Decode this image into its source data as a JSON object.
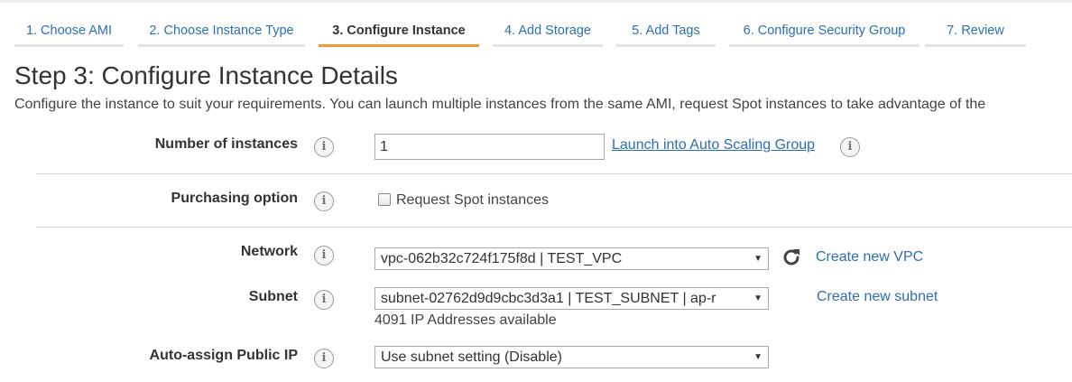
{
  "wizard_tabs": [
    {
      "label": "1. Choose AMI"
    },
    {
      "label": "2. Choose Instance Type"
    },
    {
      "label": "3. Configure Instance",
      "active": true
    },
    {
      "label": "4. Add Storage"
    },
    {
      "label": "5. Add Tags"
    },
    {
      "label": "6. Configure Security Group"
    },
    {
      "label": "7. Review"
    }
  ],
  "page": {
    "title": "Step 3: Configure Instance Details",
    "description": "Configure the instance to suit your requirements. You can launch multiple instances from the same AMI, request Spot instances to take advantage of the"
  },
  "fields": {
    "number_of_instances": {
      "label": "Number of instances",
      "value": "1",
      "link": "Launch into Auto Scaling Group"
    },
    "purchasing_option": {
      "label": "Purchasing option",
      "checkbox_label": "Request Spot instances",
      "checked": false
    },
    "network": {
      "label": "Network",
      "selected": "vpc-062b32c724f175f8d | TEST_VPC",
      "link": "Create new VPC"
    },
    "subnet": {
      "label": "Subnet",
      "selected": "subnet-02762d9d9cbc3d3a1 | TEST_SUBNET | ap-r",
      "available": "4091 IP Addresses available",
      "link": "Create new subnet"
    },
    "auto_assign_ip": {
      "label": "Auto-assign Public IP",
      "selected": "Use subnet setting (Disable)"
    }
  },
  "icons": {
    "info": "info-icon",
    "refresh": "refresh-icon",
    "dropdown": "chevron-down-icon"
  },
  "colors": {
    "link": "#2b6fb6",
    "active_tab_underline": "#f19a34",
    "tab_underline": "#e4e4e4"
  }
}
